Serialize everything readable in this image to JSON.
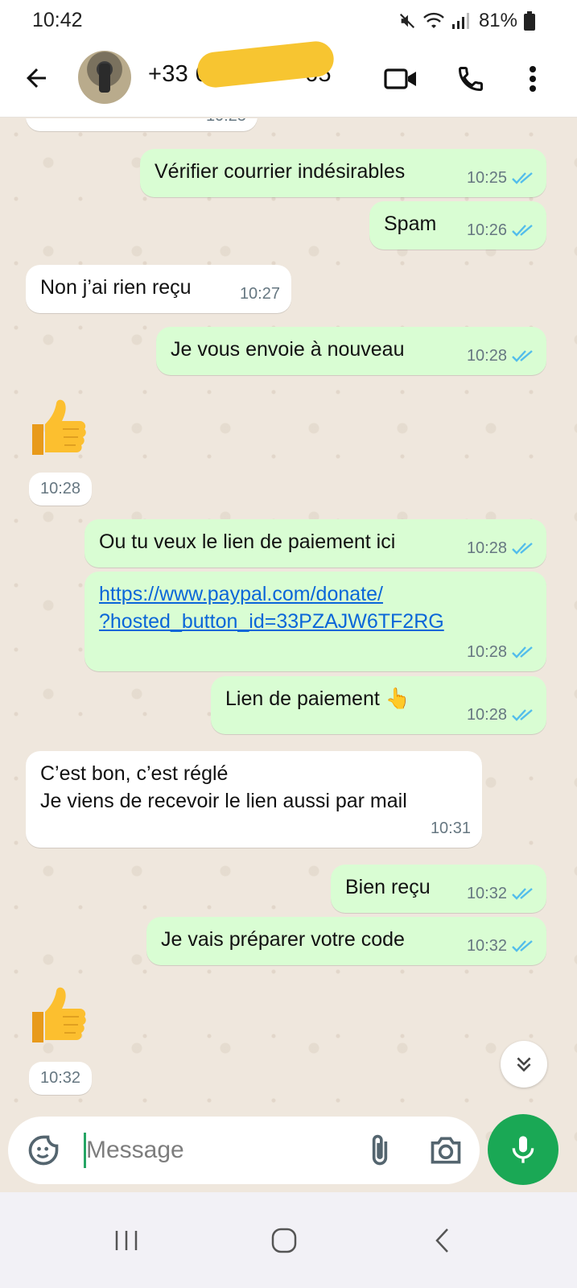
{
  "status_bar": {
    "time": "10:42",
    "battery": "81%"
  },
  "header": {
    "contact_visible_prefix": "+33 6",
    "contact_visible_suffix": "65"
  },
  "messages": [
    {
      "dir": "in",
      "text": "",
      "time": "10:25",
      "partial": true
    },
    {
      "dir": "out",
      "text": "Vérifier courrier indésirables",
      "time": "10:25"
    },
    {
      "dir": "out",
      "text": "Spam",
      "time": "10:26"
    },
    {
      "dir": "in",
      "text": "Non j’ai rien reçu",
      "time": "10:27"
    },
    {
      "dir": "out",
      "text": "Je vous envoie à nouveau",
      "time": "10:28"
    },
    {
      "dir": "in",
      "emoji": "👍",
      "time": "10:28"
    },
    {
      "dir": "out",
      "text": "Ou tu veux le lien de paiement ici",
      "time": "10:28"
    },
    {
      "dir": "out",
      "link_line1": "https://www.paypal.com/donate/",
      "link_line2": "?hosted_button_id=33PZAJW6TF2RG",
      "time": "10:28"
    },
    {
      "dir": "out",
      "text": "Lien de paiement 👆",
      "time": "10:28"
    },
    {
      "dir": "in",
      "text": "C’est bon, c’est réglé\nJe viens de recevoir le lien aussi par mail",
      "time": "10:31"
    },
    {
      "dir": "out",
      "text": "Bien reçu",
      "time": "10:32"
    },
    {
      "dir": "out",
      "text": "Je vais préparer votre code",
      "time": "10:32"
    },
    {
      "dir": "in",
      "emoji": "👍",
      "time": "10:32"
    }
  ],
  "composer": {
    "placeholder": "Message"
  },
  "colors": {
    "outgoing_bubble": "#d9fdd3",
    "incoming_bubble": "#ffffff",
    "chat_background": "#efe7dd",
    "read_ticks": "#53bdeb",
    "mic_button": "#1aa855",
    "link": "#0a66d8"
  },
  "icons": {
    "back": "arrow-left-icon",
    "video": "video-camera-icon",
    "call": "phone-icon",
    "menu": "more-vertical-icon",
    "emoji": "sticker-smiley-icon",
    "attach": "paperclip-icon",
    "camera": "camera-icon",
    "mic": "microphone-icon",
    "scroll": "double-chevron-down-icon",
    "read": "double-check-icon"
  }
}
